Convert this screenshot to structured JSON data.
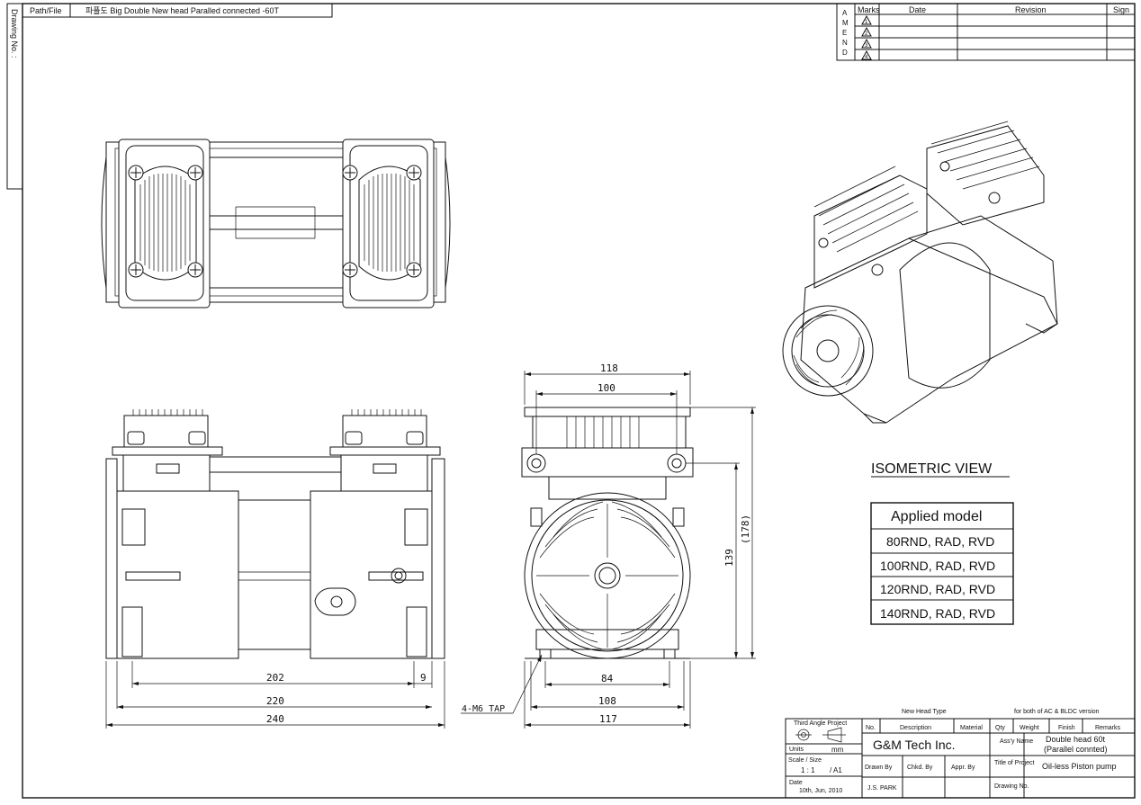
{
  "header": {
    "path_label": "Path/File",
    "path_value": "파플도 Big Double New head Paralled connected -60T",
    "drawing_no_label": "Drawing No. :"
  },
  "revision_table": {
    "amend_letters": [
      "A",
      "M",
      "E",
      "N",
      "D"
    ],
    "headers": [
      "Marks",
      "Date",
      "Revision",
      "Sign"
    ],
    "rows": [
      [
        "1",
        "",
        "",
        ""
      ],
      [
        "2",
        "",
        "",
        ""
      ],
      [
        "3",
        "",
        "",
        ""
      ],
      [
        "4",
        "",
        "",
        ""
      ]
    ]
  },
  "dimensions": {
    "front_right": {
      "w118": "118",
      "w100": "100",
      "h139": "139",
      "h178": "(178)",
      "w84": "84",
      "w108": "108",
      "w117": "117"
    },
    "side": {
      "w202": "202",
      "w9": "9",
      "w220": "220",
      "w240": "240"
    },
    "tap_label": "4-M6 TAP"
  },
  "isometric_title": "ISOMETRIC VIEW",
  "applied_model": {
    "title": "Applied model",
    "rows": [
      "80RND, RAD, RVD",
      "100RND, RAD, RVD",
      "120RND, RAD, RVD",
      "140RND, RAD, RVD"
    ]
  },
  "title_block": {
    "new_head_type": "New Head Type",
    "ac_bldc": "for both of AC & BLDC version",
    "third_angle": "Third Angle Project",
    "units_label": "Units",
    "units_value": "mm",
    "scale_label": "Scale / Size",
    "scale_value": "1 : 1",
    "size_value": "/ A1",
    "date_label": "Date",
    "date_value": "10th, Jun, 2010",
    "col_no": "No.",
    "col_desc": "Description",
    "col_material": "Material",
    "col_qty": "Qty",
    "col_weight": "Weight",
    "col_finish": "Finish",
    "col_remarks": "Remarks",
    "company": "G&M Tech Inc.",
    "assy_label": "Ass'y Name",
    "assy_value1": "Double head 60t",
    "assy_value2": "(Parallel connted)",
    "drawn_by": "Drawn By",
    "chkd_by": "Chkd. By",
    "appr_by": "Appr. By",
    "title_of_project_label": "Title of Project",
    "title_of_project": "Oil-less Piston pump",
    "drawer": "J.S. PARK",
    "drawing_no_label": "Drawing No."
  }
}
